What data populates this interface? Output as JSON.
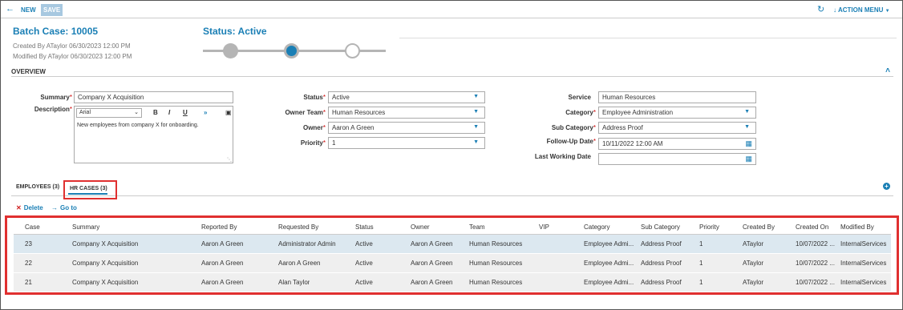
{
  "toolbar": {
    "back_icon": "back-arrow-icon",
    "new_label": "NEW",
    "save_label": "SAVE",
    "refresh_icon": "refresh-icon",
    "action_menu_label": "ACTION MENU"
  },
  "header": {
    "title": "Batch Case: 10005",
    "created": "Created By ATaylor 06/30/2023 12:00 PM",
    "modified": "Modified By ATaylor 06/30/2023 12:00 PM",
    "status": "Status: Active",
    "stepper": {
      "total_steps": 3,
      "current_step": 2
    }
  },
  "overview": {
    "title": "OVERVIEW",
    "summary": {
      "label": "Summary",
      "value": "Company X Acquisition"
    },
    "description": {
      "label": "Description",
      "font": "Arial",
      "bold": "B",
      "italic": "I",
      "underline": "U",
      "more": "»",
      "value": "New employees from company X for onboarding."
    },
    "status": {
      "label": "Status",
      "value": "Active"
    },
    "owner_team": {
      "label": "Owner Team",
      "value": "Human Resources"
    },
    "owner": {
      "label": "Owner",
      "value": "Aaron A Green"
    },
    "priority": {
      "label": "Priority",
      "value": "1"
    },
    "service": {
      "label": "Service",
      "value": "Human Resources"
    },
    "category": {
      "label": "Category",
      "value": "Employee Administration"
    },
    "sub_category": {
      "label": "Sub Category",
      "value": "Address Proof"
    },
    "follow_up_date": {
      "label": "Follow-Up Date",
      "value": "10/11/2022 12:00 AM"
    },
    "last_working_date": {
      "label": "Last Working Date",
      "value": ""
    }
  },
  "tabs": {
    "employees": "EMPLOYEES (3)",
    "hr_cases": "HR CASES (3)",
    "active": "hr_cases"
  },
  "actions": {
    "delete": "Delete",
    "goto": "Go to"
  },
  "table": {
    "columns": [
      "Case",
      "Summary",
      "Reported By",
      "Requested By",
      "Status",
      "Owner",
      "Team",
      "VIP",
      "Category",
      "Sub Category",
      "Priority",
      "Created By",
      "Created On",
      "Modified By"
    ],
    "rows": [
      [
        "23",
        "Company X Acquisition",
        "Aaron A Green",
        "Administrator Admin",
        "Active",
        "Aaron A Green",
        "Human Resources",
        "",
        "Employee Admi...",
        "Address Proof",
        "1",
        "ATaylor",
        "10/07/2022 ...",
        "InternalServices"
      ],
      [
        "22",
        "Company X Acquisition",
        "Aaron A Green",
        "Aaron A Green",
        "Active",
        "Aaron A Green",
        "Human Resources",
        "",
        "Employee Admi...",
        "Address Proof",
        "1",
        "ATaylor",
        "10/07/2022 ...",
        "InternalServices"
      ],
      [
        "21",
        "Company X Acquisition",
        "Aaron A Green",
        "Alan Taylor",
        "Active",
        "Aaron A Green",
        "Human Resources",
        "",
        "Employee Admi...",
        "Address Proof",
        "1",
        "ATaylor",
        "10/07/2022 ...",
        "InternalServices"
      ]
    ],
    "selected_row": 0
  },
  "colors": {
    "accent": "#1a7fb5",
    "highlight": "#e03030",
    "required": "#cc0000"
  }
}
